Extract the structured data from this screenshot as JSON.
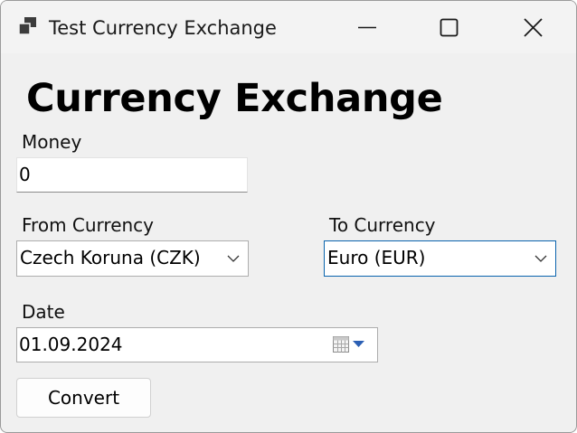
{
  "window": {
    "title": "Test Currency Exchange",
    "controls": {
      "minimize": "minimize-icon",
      "maximize": "maximize-icon",
      "close": "close-icon"
    }
  },
  "form": {
    "heading": "Currency Exchange",
    "money": {
      "label": "Money",
      "value": "0"
    },
    "from_currency": {
      "label": "From Currency",
      "selected": "Czech Koruna (CZK)"
    },
    "to_currency": {
      "label": "To Currency",
      "selected": "Euro (EUR)"
    },
    "date": {
      "label": "Date",
      "value": "01.09.2024"
    },
    "convert_label": "Convert"
  },
  "colors": {
    "window_bg": "#f0f0f0",
    "focus_border": "#0a64ad",
    "calendar_arrow": "#2b5fb4"
  }
}
